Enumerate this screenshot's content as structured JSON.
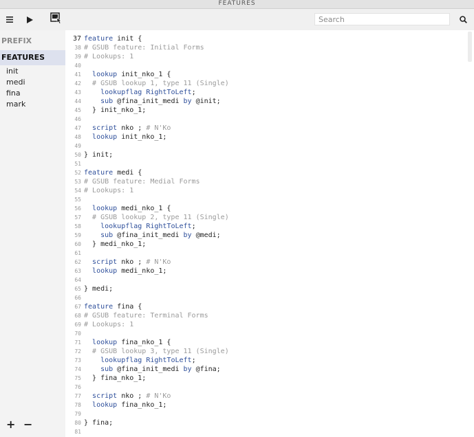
{
  "window": {
    "title": "FEATURES"
  },
  "toolbar": {
    "menu_icon": "hamburger-menu-icon",
    "run_icon": "play-icon",
    "compile_icon": "panel-cursor-icon",
    "search_placeholder": "Search",
    "search_icon": "magnifier-icon"
  },
  "sidebar": {
    "sections": [
      {
        "label": "PREFIX",
        "active": false
      },
      {
        "label": "FEATURES",
        "active": true
      }
    ],
    "items": [
      "init",
      "medi",
      "fina",
      "mark"
    ],
    "add_label": "+",
    "remove_label": "−"
  },
  "editor": {
    "current_line": 37,
    "lines": [
      {
        "n": "37",
        "t": "feature init {"
      },
      {
        "n": "38",
        "t": "# GSUB feature: Initial Forms"
      },
      {
        "n": "39",
        "t": "# Lookups: 1"
      },
      {
        "n": "40",
        "t": ""
      },
      {
        "n": "41",
        "t": "  lookup init_nko_1 {"
      },
      {
        "n": "42",
        "t": "  # GSUB lookup 1, type 11 (Single)"
      },
      {
        "n": "43",
        "t": "    lookupflag RightToLeft;"
      },
      {
        "n": "44",
        "t": "    sub @fina_init_medi by @init;"
      },
      {
        "n": "45",
        "t": "  } init_nko_1;"
      },
      {
        "n": "46",
        "t": ""
      },
      {
        "n": "47",
        "t": "  script nko ; # N'Ko"
      },
      {
        "n": "48",
        "t": "  lookup init_nko_1;"
      },
      {
        "n": "49",
        "t": ""
      },
      {
        "n": "50",
        "t": "} init;"
      },
      {
        "n": "51",
        "t": ""
      },
      {
        "n": "52",
        "t": "feature medi {"
      },
      {
        "n": "53",
        "t": "# GSUB feature: Medial Forms"
      },
      {
        "n": "54",
        "t": "# Lookups: 1"
      },
      {
        "n": "55",
        "t": ""
      },
      {
        "n": "56",
        "t": "  lookup medi_nko_1 {"
      },
      {
        "n": "57",
        "t": "  # GSUB lookup 2, type 11 (Single)"
      },
      {
        "n": "58",
        "t": "    lookupflag RightToLeft;"
      },
      {
        "n": "59",
        "t": "    sub @fina_init_medi by @medi;"
      },
      {
        "n": "60",
        "t": "  } medi_nko_1;"
      },
      {
        "n": "61",
        "t": ""
      },
      {
        "n": "62",
        "t": "  script nko ; # N'Ko"
      },
      {
        "n": "63",
        "t": "  lookup medi_nko_1;"
      },
      {
        "n": "64",
        "t": ""
      },
      {
        "n": "65",
        "t": "} medi;"
      },
      {
        "n": "66",
        "t": ""
      },
      {
        "n": "67",
        "t": "feature fina {"
      },
      {
        "n": "68",
        "t": "# GSUB feature: Terminal Forms"
      },
      {
        "n": "69",
        "t": "# Lookups: 1"
      },
      {
        "n": "70",
        "t": ""
      },
      {
        "n": "71",
        "t": "  lookup fina_nko_1 {"
      },
      {
        "n": "72",
        "t": "  # GSUB lookup 3, type 11 (Single)"
      },
      {
        "n": "73",
        "t": "    lookupflag RightToLeft;"
      },
      {
        "n": "74",
        "t": "    sub @fina_init_medi by @fina;"
      },
      {
        "n": "75",
        "t": "  } fina_nko_1;"
      },
      {
        "n": "76",
        "t": ""
      },
      {
        "n": "77",
        "t": "  script nko ; # N'Ko"
      },
      {
        "n": "78",
        "t": "  lookup fina_nko_1;"
      },
      {
        "n": "79",
        "t": ""
      },
      {
        "n": "80",
        "t": "} fina;"
      },
      {
        "n": "81",
        "t": ""
      }
    ]
  },
  "colors": {
    "keyword": "#2d4e9a",
    "comment": "#9a9a9a",
    "sidebar_bg": "#f3f3f3",
    "sidebar_active": "#dde1ee"
  }
}
